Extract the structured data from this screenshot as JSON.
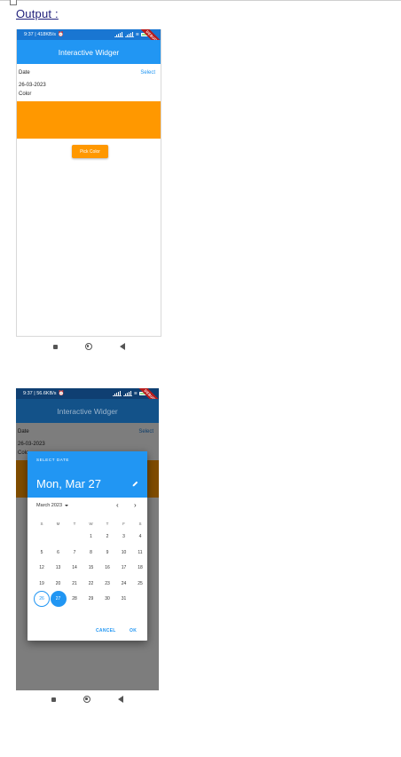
{
  "output_label": "Output :",
  "phone1": {
    "status": "9:37 | 418KB/s",
    "debug_banner": "DEBUG",
    "app_title": "Interactive Widger",
    "date_label": "Date",
    "select_label": "Select",
    "date_value": "26-03-2023",
    "color_label": "Color",
    "color_value": "#ff9800",
    "pick_color_label": "Pick Color"
  },
  "phone2": {
    "status": "9:37 | 56.6KB/s",
    "debug_banner": "DEBUG",
    "app_title": "Interactive Widger",
    "date_label": "Date",
    "select_label": "Select",
    "date_value": "26-03-2023",
    "color_label": "Colo"
  },
  "date_picker": {
    "header_label": "SELECT DATE",
    "selected_date_text": "Mon, Mar 27",
    "month_label": "March 2023",
    "weekdays": [
      "S",
      "M",
      "T",
      "W",
      "T",
      "F",
      "S"
    ],
    "first_weekday_index": 3,
    "days_in_month": 31,
    "today": 26,
    "selected": 27,
    "cancel_label": "CANCEL",
    "ok_label": "OK"
  },
  "colors": {
    "primary": "#2196f3",
    "accent": "#ff9800"
  }
}
